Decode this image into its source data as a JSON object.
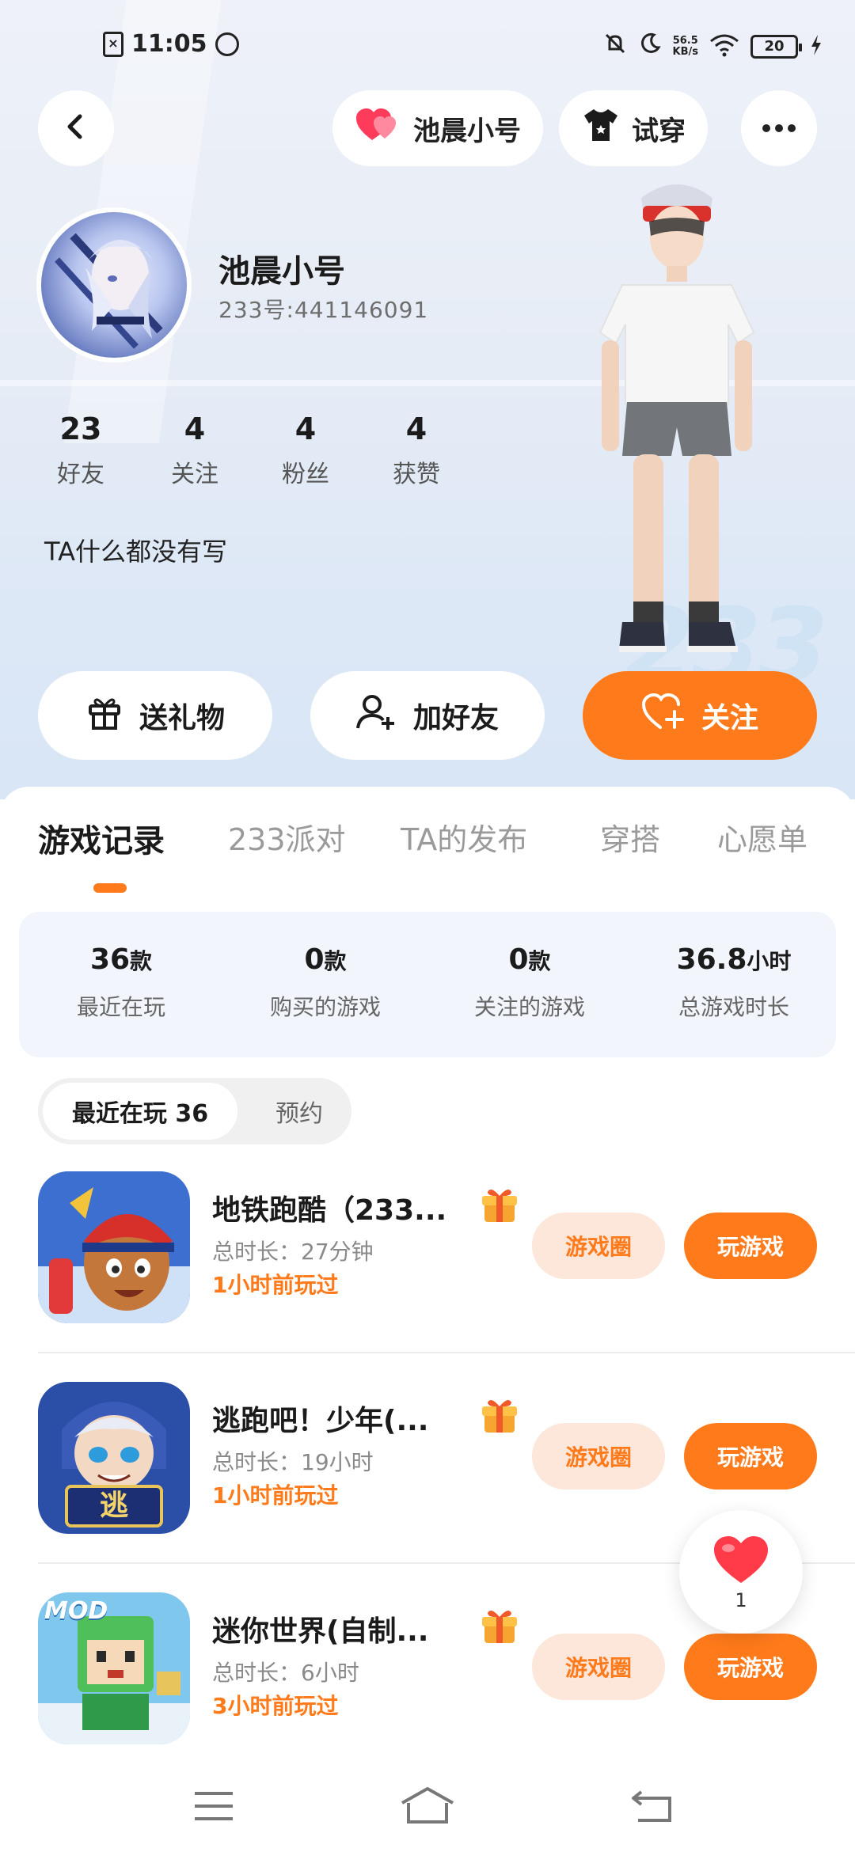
{
  "status_bar": {
    "time": "11:05",
    "net_speed_value": "56.5",
    "net_speed_unit": "KB/s",
    "battery": "20"
  },
  "header": {
    "back_icon": "chevron-left-icon",
    "account_pill_label": "池晨小号",
    "tryon_label": "试穿",
    "more_icon": "more-horizontal-icon"
  },
  "profile": {
    "nickname": "池晨小号",
    "uid": "233号:441146091",
    "stats": [
      {
        "value": "23",
        "label": "好友"
      },
      {
        "value": "4",
        "label": "关注"
      },
      {
        "value": "4",
        "label": "粉丝"
      },
      {
        "value": "4",
        "label": "获赞"
      }
    ],
    "bio": "TA什么都没有写"
  },
  "actions": {
    "gift_label": "送礼物",
    "add_friend_label": "加好友",
    "follow_label": "关注"
  },
  "tabs": [
    "游戏记录",
    "233派对",
    "TA的发布",
    "穿搭",
    "心愿单"
  ],
  "summary": [
    {
      "value": "36",
      "unit": "款",
      "label": "最近在玩"
    },
    {
      "value": "0",
      "unit": "款",
      "label": "购买的游戏"
    },
    {
      "value": "0",
      "unit": "款",
      "label": "关注的游戏"
    },
    {
      "value": "36.8",
      "unit": "小时",
      "label": "总游戏时长"
    }
  ],
  "segment": {
    "active_label": "最近在玩 36",
    "inactive_label": "预约"
  },
  "games": [
    {
      "title": "地铁跑酷（233...",
      "duration": "总时长：27分钟",
      "last_played": "1小时前玩过",
      "circle_label": "游戏圈",
      "play_label": "玩游戏"
    },
    {
      "title": "逃跑吧！少年(...",
      "duration": "总时长：19小时",
      "last_played": "1小时前玩过",
      "circle_label": "游戏圈",
      "play_label": "玩游戏"
    },
    {
      "title": "迷你世界(自制...",
      "duration": "总时长：6小时",
      "last_played": "3小时前玩过",
      "circle_label": "游戏圈",
      "play_label": "玩游戏"
    }
  ],
  "game_icon_texts": {
    "second_badge": "逃",
    "third_badge": "MOD"
  },
  "fab": {
    "count": "1"
  },
  "decor_text": "233",
  "colors": {
    "accent": "#ff7a1a",
    "accent_soft": "#fde6da",
    "heart": "#ff3b5c",
    "summary_bg": "#f2f6fc"
  }
}
